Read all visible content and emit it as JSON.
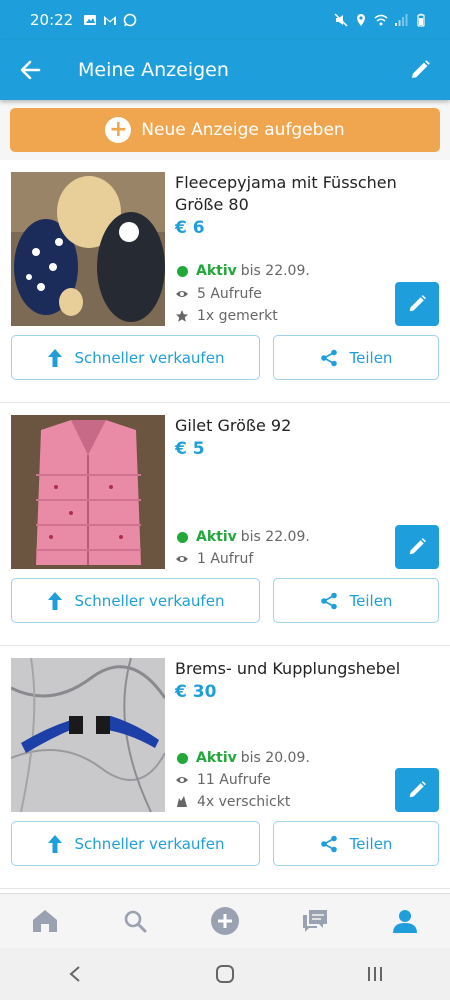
{
  "status_bar": {
    "time": "20:22"
  },
  "app_bar": {
    "title": "Meine Anzeigen"
  },
  "new_ad_button": {
    "label": "Neue Anzeige aufgeben"
  },
  "listings": [
    {
      "title": "Fleecepyjama mit Füsschen Größe 80",
      "price": "€ 6",
      "status": "Aktiv",
      "until": "bis 22.09.",
      "views": "5 Aufrufe",
      "extra": "1x gemerkt",
      "extra_icon": "star-icon",
      "sell_label": "Schneller verkaufen",
      "share_label": "Teilen"
    },
    {
      "title": "Gilet Größe 92",
      "price": "€ 5",
      "status": "Aktiv",
      "until": "bis 22.09.",
      "views": "1 Aufruf",
      "sell_label": "Schneller verkaufen",
      "share_label": "Teilen"
    },
    {
      "title": "Brems- und Kupplungshebel",
      "price": "€ 30",
      "status": "Aktiv",
      "until": "bis 20.09.",
      "views": "11 Aufrufe",
      "extra": "4x verschickt",
      "extra_icon": "paper-plane-icon",
      "sell_label": "Schneller verkaufen",
      "share_label": "Teilen"
    }
  ],
  "bottom_nav": [
    "home-icon",
    "search-icon",
    "add-icon",
    "messages-icon",
    "profile-icon"
  ],
  "colors": {
    "primary": "#1e9fdb",
    "accent": "#f0a64e",
    "active_green": "#22a83a"
  }
}
